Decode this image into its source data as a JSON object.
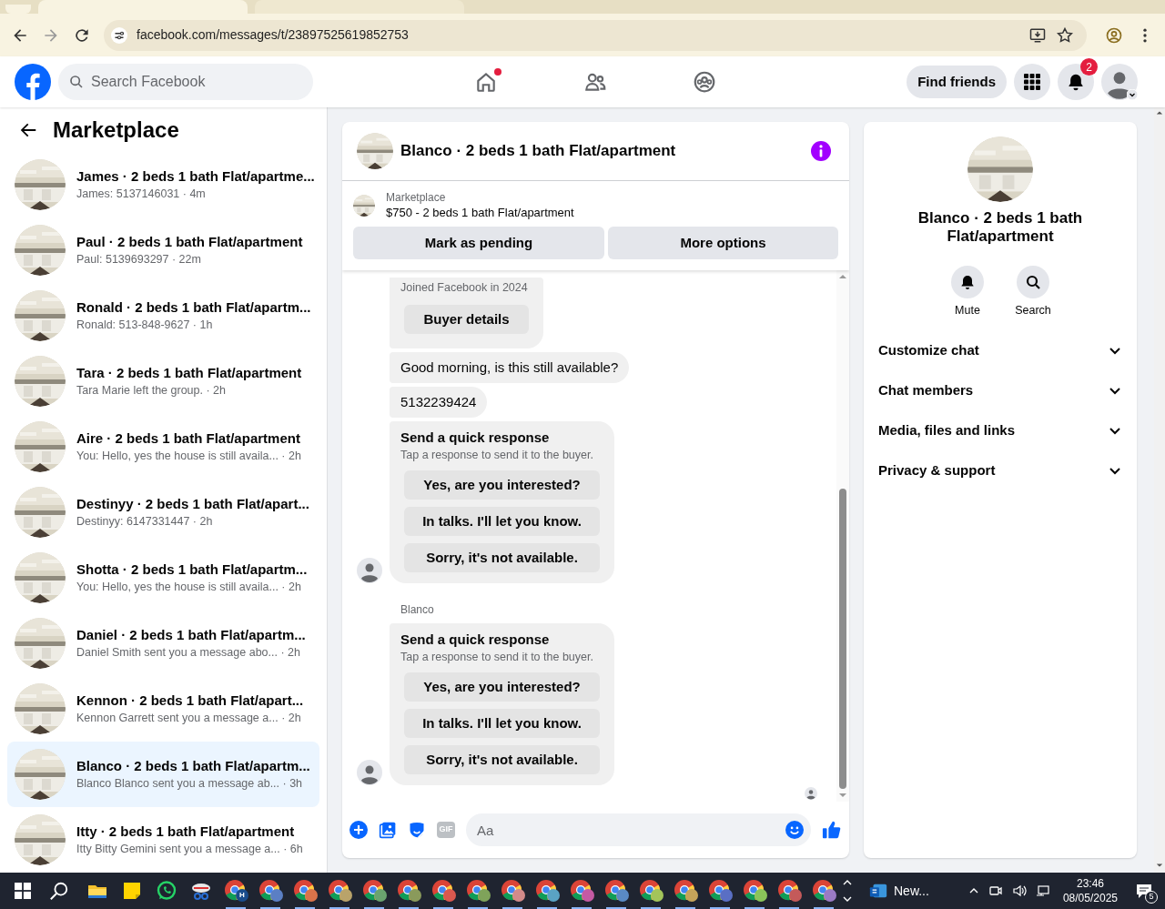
{
  "browser": {
    "url": "facebook.com/messages/t/23897525619852753"
  },
  "header": {
    "search_placeholder": "Search Facebook",
    "nav": [
      {
        "kind": "home",
        "notification_dot": true
      },
      {
        "kind": "friends",
        "notification_dot": false
      },
      {
        "kind": "groups",
        "notification_dot": false
      }
    ],
    "find_friends": "Find friends",
    "notification_count": "2"
  },
  "sidebar": {
    "title": "Marketplace",
    "conversations": [
      {
        "title": "James · 2 beds 1 bath Flat/apartme...",
        "preview": "James: 5137146031 · 4m",
        "selected": false
      },
      {
        "title": "Paul · 2 beds 1 bath Flat/apartment",
        "preview": "Paul: 5139693297 · 22m",
        "selected": false
      },
      {
        "title": "Ronald · 2 beds 1 bath Flat/apartm...",
        "preview": "Ronald: 513-848-9627 · 1h",
        "selected": false
      },
      {
        "title": "Tara · 2 beds 1 bath Flat/apartment",
        "preview": "Tara Marie left the group. · 2h",
        "selected": false
      },
      {
        "title": "Aire · 2 beds 1 bath Flat/apartment",
        "preview": "You: Hello, yes the house is still availa...  · 2h",
        "selected": false
      },
      {
        "title": "Destinyy · 2 beds 1 bath Flat/apart...",
        "preview": "Destinyy: 6147331447 · 2h",
        "selected": false
      },
      {
        "title": "Shotta · 2 beds 1 bath Flat/apartm...",
        "preview": "You: Hello, yes the house is still availa...  · 2h",
        "selected": false
      },
      {
        "title": "Daniel · 2 beds 1 bath Flat/apartm...",
        "preview": "Daniel Smith sent you a message abo...  · 2h",
        "selected": false
      },
      {
        "title": "Kennon · 2 beds 1 bath Flat/apart...",
        "preview": "Kennon Garrett sent you a message a...  · 2h",
        "selected": false
      },
      {
        "title": "Blanco · 2 beds 1 bath Flat/apartm...",
        "preview": "Blanco Blanco sent you a message ab...  · 3h",
        "selected": true
      },
      {
        "title": "Itty · 2 beds 1 bath Flat/apartment",
        "preview": "Itty Bitty Gemini sent you a message a... · 6h",
        "selected": false
      }
    ]
  },
  "chat": {
    "title": "Blanco · 2 beds 1 bath Flat/apartment",
    "listing": {
      "source": "Marketplace",
      "name": "$750 - 2 beds 1 bath Flat/apartment",
      "buttons": [
        "Mark as pending",
        "More options"
      ]
    },
    "messages": [
      {
        "kind": "profile",
        "subtitle": "Joined Facebook in 2024",
        "button": "Buyer details",
        "show_avatar": false
      },
      {
        "kind": "text",
        "text": "Good morning, is this still available?",
        "show_avatar": false
      },
      {
        "kind": "text",
        "text": "5132239424",
        "show_avatar": false
      },
      {
        "kind": "quick_response",
        "title": "Send a quick response",
        "subtitle": "Tap a response to send it to the buyer.",
        "options": [
          "Yes, are you interested?",
          "In talks. I'll let you know.",
          "Sorry, it's not available."
        ],
        "show_avatar": true
      },
      {
        "kind": "quick_response",
        "sender": "Blanco",
        "title": "Send a quick response",
        "subtitle": "Tap a response to send it to the buyer.",
        "options": [
          "Yes, are you interested?",
          "In talks. I'll let you know.",
          "Sorry, it's not available."
        ],
        "show_avatar": true
      }
    ],
    "composer": {
      "gif": "GIF",
      "placeholder": "Aa"
    }
  },
  "details": {
    "title": "Blanco · 2 beds 1 bath Flat/apartment",
    "actions": [
      {
        "kind": "bell",
        "label": "Mute"
      },
      {
        "kind": "search",
        "label": "Search"
      }
    ],
    "sections": [
      {
        "label": "Customize chat",
        "expanded": false
      },
      {
        "label": "Chat members",
        "expanded": false
      },
      {
        "label": "Media, files and links",
        "expanded": false
      },
      {
        "label": "Privacy & support",
        "expanded": false
      }
    ]
  },
  "taskbar": {
    "apps": [
      {
        "kind": "explorer"
      },
      {
        "kind": "notes"
      },
      {
        "kind": "whatsapp"
      },
      {
        "kind": "snip"
      },
      {
        "kind": "chrome",
        "badge": "H",
        "color": "#1a4c8c"
      },
      {
        "kind": "chrome",
        "color": "#5b7fc4"
      },
      {
        "kind": "chrome",
        "color": "#d9734a"
      },
      {
        "kind": "chrome",
        "color": "#b9a36a"
      },
      {
        "kind": "chrome",
        "color": "#6aa36f"
      },
      {
        "kind": "chrome",
        "color": "#8a9a5b"
      },
      {
        "kind": "chrome",
        "color": "#d9584f"
      },
      {
        "kind": "chrome",
        "color": "#7fa35a"
      },
      {
        "kind": "chrome",
        "color": "#d28a8a"
      },
      {
        "kind": "chrome",
        "color": "#5aa3c4"
      },
      {
        "kind": "chrome",
        "color": "#c45aa3"
      },
      {
        "kind": "chrome",
        "color": "#5a8ac4"
      },
      {
        "kind": "chrome",
        "color": "#a3c45a"
      },
      {
        "kind": "chrome",
        "color": "#c4a35a"
      },
      {
        "kind": "chrome",
        "color": "#5a6fc4"
      },
      {
        "kind": "chrome",
        "color": "#8ac45a"
      },
      {
        "kind": "chrome",
        "color": "#c45a5a"
      },
      {
        "kind": "chrome",
        "color": "#9a7ac4"
      }
    ],
    "news": "New...",
    "time": "23:46",
    "date": "08/05/2025",
    "notifications": "5"
  }
}
